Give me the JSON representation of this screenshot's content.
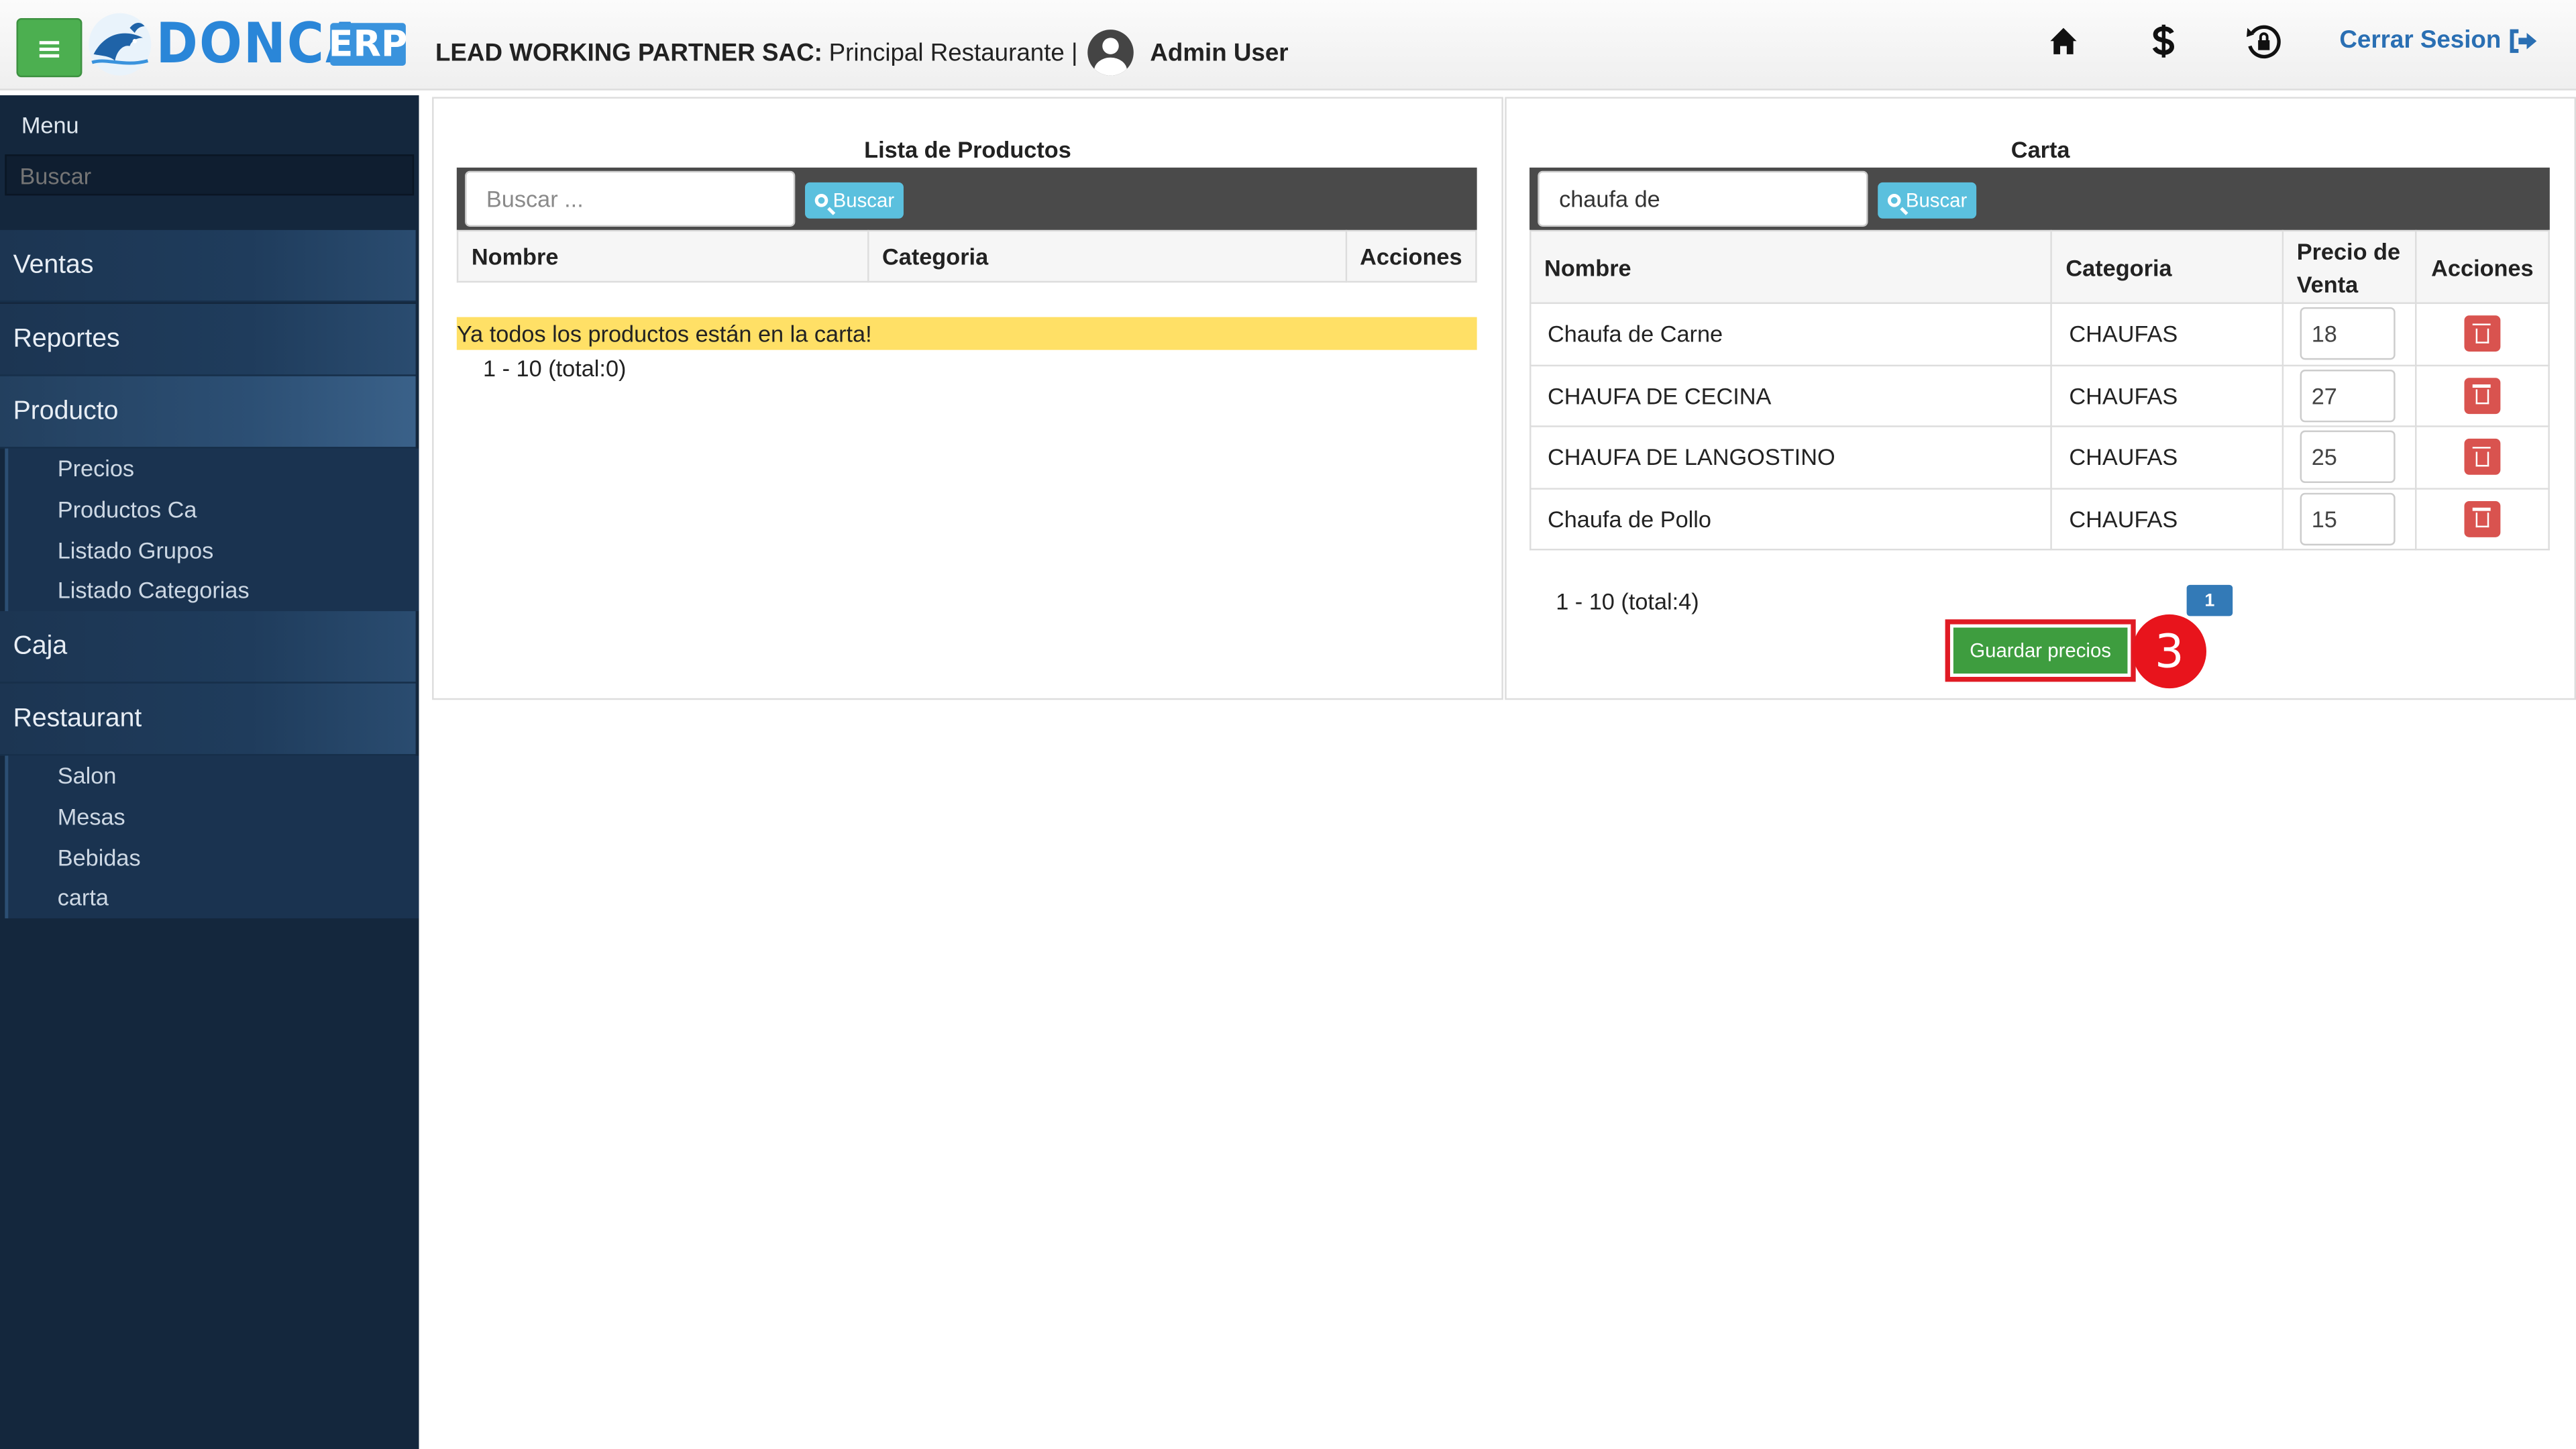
{
  "header": {
    "logo_text": "DONCA",
    "logo_badge": "ERP",
    "company_bold": "LEAD WORKING PARTNER SAC:",
    "company_rest": "Principal Restaurante |",
    "user_name": "Admin User",
    "logout_label": "Cerrar Sesion",
    "icons": [
      "home-icon",
      "dollar-icon",
      "lock-rotate-icon",
      "sign-out-icon"
    ],
    "accent": "#4caf50",
    "brand_blue": "#2a86d8"
  },
  "sidebar": {
    "title": "Menu",
    "search_placeholder": "Buscar",
    "sections": {
      "ventas": "Ventas",
      "reportes": "Reportes",
      "producto": "Producto",
      "caja": "Caja",
      "restaurant": "Restaurant"
    },
    "producto_items": [
      "Precios",
      "Productos Ca",
      "Listado Grupos",
      "Listado Categorias"
    ],
    "restaurant_items": [
      "Salon",
      "Mesas",
      "Bebidas",
      "carta"
    ]
  },
  "products_panel": {
    "title": "Lista de Productos",
    "search_placeholder": "Buscar ...",
    "search_value": "",
    "search_button": "Buscar",
    "columns": [
      "Nombre",
      "Categoria",
      "Acciones"
    ],
    "empty_message": "Ya todos los productos están en la carta!",
    "pager": "1 - 10 (total:0)"
  },
  "carta_panel": {
    "title": "Carta",
    "search_value": "chaufa de",
    "search_button": "Buscar",
    "columns": [
      "Nombre",
      "Categoria",
      "Precio de Venta",
      "Acciones"
    ],
    "rows": [
      {
        "nombre": "Chaufa de Carne",
        "categoria": "CHAUFAS",
        "precio": "18"
      },
      {
        "nombre": "CHAUFA DE CECINA",
        "categoria": "CHAUFAS",
        "precio": "27"
      },
      {
        "nombre": "CHAUFA DE LANGOSTINO",
        "categoria": "CHAUFAS",
        "precio": "25"
      },
      {
        "nombre": "Chaufa de Pollo",
        "categoria": "CHAUFAS",
        "precio": "15"
      }
    ],
    "pager": "1 - 10 (total:4)",
    "page_number": "1",
    "save_button": "Guardar precios",
    "step_marker": "3"
  }
}
